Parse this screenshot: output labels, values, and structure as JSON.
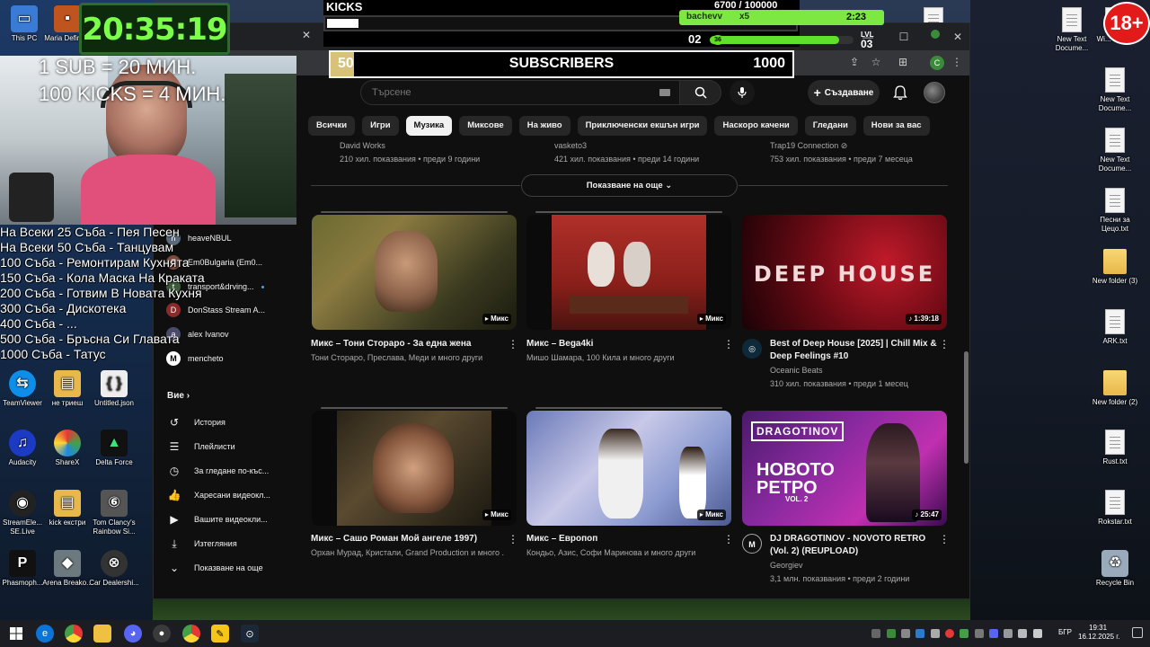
{
  "overlay": {
    "clock": "20:35:19",
    "sub_rule": "1 SUB = 20 МИН.",
    "kicks_rule": "100 KICKS = 4 МИН.",
    "kicks_title": "KICKS",
    "kicks_progress": "6700 / 100000",
    "kicks_user": "bachevv",
    "kicks_multiplier": "x5",
    "kicks_timer": "2:23",
    "level_prefix": "02",
    "level_badge": "36",
    "level_label": "LVL",
    "level_value": "03",
    "subs_current": "50",
    "subs_label": "SUBSCRIBERS",
    "subs_goal": "1000",
    "age_badge": "18+",
    "rules": [
      "На Всеки 25 Съба - Пея Песен",
      "На Всеки 50 Съба - Танцувам",
      "100 Съба - Ремонтирам Кухнята",
      "150 Съба - Кола Маска На Краката",
      "200 Съба - Готвим В Новата Кухня",
      "300 Съба - Дискотека",
      "400 Съба - ...",
      "500 Съба - Бръсна Си Главата",
      "1000 Съба - Татус"
    ]
  },
  "desktop_left": [
    {
      "label": "This PC",
      "icon": "pc-icon"
    },
    {
      "label": "Maria Definit...",
      "icon": "folder-icon"
    },
    {
      "label": "TeamViewer",
      "icon": "teamviewer-icon"
    },
    {
      "label": "не триеш",
      "icon": "file-icon"
    },
    {
      "label": "Untitled.json",
      "icon": "file-icon"
    },
    {
      "label": "Audacity",
      "icon": "audacity-icon"
    },
    {
      "label": "ShareX",
      "icon": "sharex-icon"
    },
    {
      "label": "Delta Force",
      "icon": "deltaforce-icon"
    },
    {
      "label": "StreamEle... SE.Live",
      "icon": "streamelements-icon"
    },
    {
      "label": "kick екстри",
      "icon": "file-icon"
    },
    {
      "label": "Tom Clancy's Rainbow Si...",
      "icon": "rainbow-icon"
    },
    {
      "label": "Phasmoph...",
      "icon": "phasmophobia-icon"
    },
    {
      "label": "Arena Breako...",
      "icon": "arena-icon"
    },
    {
      "label": "Car Dealershi...",
      "icon": "car-icon"
    }
  ],
  "desktop_right": [
    {
      "label": "New Text Docume...",
      "type": "doc"
    },
    {
      "label": "New Text Docume...",
      "type": "doc"
    },
    {
      "label": "New Text Docume...",
      "type": "doc"
    },
    {
      "label": "Песни за Цецо.txt",
      "type": "doc"
    },
    {
      "label": "New folder (3)",
      "type": "folder"
    },
    {
      "label": "ARK.txt",
      "type": "doc"
    },
    {
      "label": "New folder (2)",
      "type": "folder"
    },
    {
      "label": "Rust.txt",
      "type": "doc"
    },
    {
      "label": "Rokstar.txt",
      "type": "doc"
    },
    {
      "label": "Recycle Bin",
      "type": "bin"
    },
    {
      "label": "Wi... key.txt",
      "type": "doc"
    }
  ],
  "youtube": {
    "search_placeholder": "Търсене",
    "create_label": "Създаване",
    "chips": [
      "Всички",
      "Игри",
      "Музика",
      "Миксове",
      "На живо",
      "Приключенски екшън игри",
      "Наскоро качени",
      "Гледани",
      "Нови за вас"
    ],
    "active_chip": "Музика",
    "prev_row": [
      {
        "channel": "David Works",
        "meta": "210 хил. показвания • преди 9 години"
      },
      {
        "channel": "vasketo3",
        "meta": "421 хил. показвания • преди 14 години"
      },
      {
        "channel": "Trap19 Connection ⊘",
        "meta": "753 хил. показвания • преди 7 месеца"
      }
    ],
    "show_more": "Показване на още",
    "videos": [
      {
        "title": "Микс – Тони Сторaро - За една жена",
        "meta1": "Тони Стораро, Преслава, Меди и много други",
        "meta2": "",
        "badge": "Микс"
      },
      {
        "title": "Микс – Bega4ki",
        "meta1": "Мишо Шамара, 100 Кила и много други",
        "meta2": "",
        "badge": "Микс"
      },
      {
        "title": "Best of Deep House [2025] | Chill Mix & Deep Feelings #10",
        "meta1": "Oceanic Beats",
        "meta2": "310 хил. показвания • преди 1 месец",
        "badge": "1:39:18",
        "thumb_text": "DEEP HOUSE"
      },
      {
        "title": "Микс – Сашо Роман  Мой ангеле 1997)",
        "meta1": "Орхан Мурад, Кристали, Grand Production и много ...",
        "meta2": "",
        "badge": "Микс"
      },
      {
        "title": "Микс – Европоп",
        "meta1": "Кондьо, Азис, Софи Маринова и много други",
        "meta2": "",
        "badge": "Микс"
      },
      {
        "title": "DJ DRAGOTINOV - NOVOTO RETRO (Vol. 2) (REUPLOAD)",
        "meta1": "Georgiev",
        "meta2": "3,1 млн. показвания • преди 2 години",
        "badge": "25:47",
        "thumb_text": "DRAGOTINOV",
        "thumb_text2": "НОВОТО РЕТРО",
        "thumb_text3": "VOL. 2"
      }
    ],
    "subscriptions": [
      {
        "name": "heaveNBUL",
        "initial": "h"
      },
      {
        "name": "Em0Bulgaria (Em0...",
        "initial": "E"
      },
      {
        "name": "transport&drving...",
        "initial": "t"
      },
      {
        "name": "DonStass Stream A...",
        "initial": "D"
      },
      {
        "name": "alex Ivanov",
        "initial": "a"
      },
      {
        "name": "mencheto",
        "initial": "M"
      }
    ],
    "you_section": "Вие",
    "you_items": [
      {
        "label": "История",
        "icon": "history-icon"
      },
      {
        "label": "Плейлисти",
        "icon": "playlist-icon"
      },
      {
        "label": "За гледане по-къс...",
        "icon": "watch-later-icon"
      },
      {
        "label": "Харесани видеокл...",
        "icon": "like-icon"
      },
      {
        "label": "Вашите видеокли...",
        "icon": "your-videos-icon"
      },
      {
        "label": "Изтегляния",
        "icon": "download-icon"
      },
      {
        "label": "Показване на още",
        "icon": "chevron-down-icon"
      }
    ]
  },
  "taskbar": {
    "time": "19:31",
    "date": "16.12.2025 г.",
    "lang": "БГР"
  }
}
